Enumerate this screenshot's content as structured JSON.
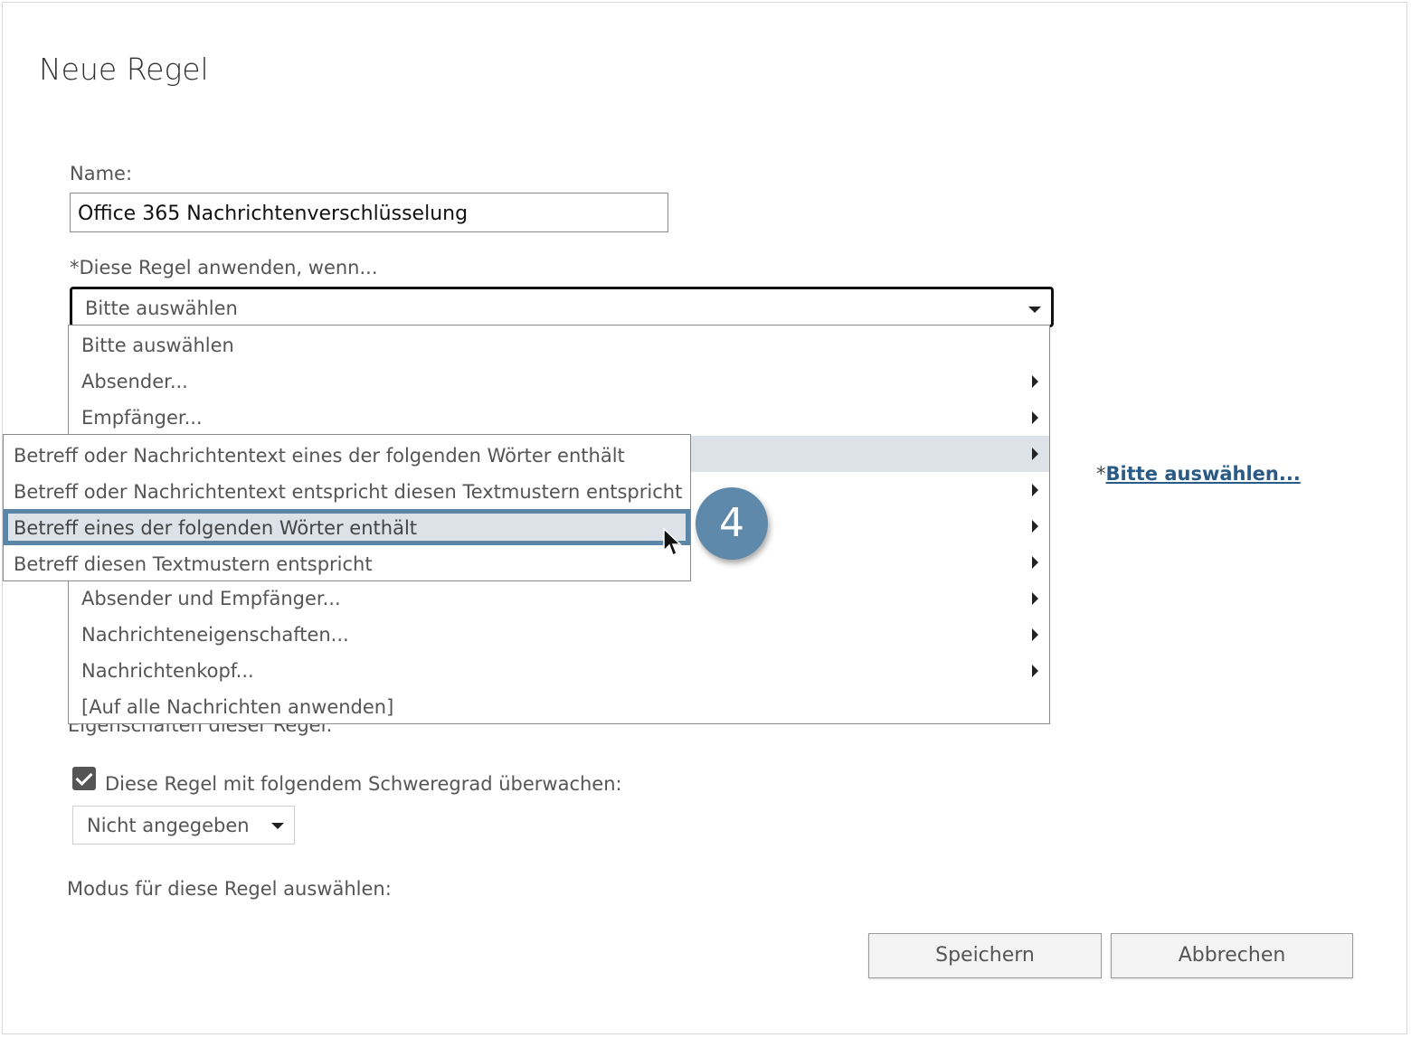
{
  "dialog": {
    "title": "Neue Regel"
  },
  "name_field": {
    "label": "Name:",
    "value": "Office 365 Nachrichtenverschlüsselung"
  },
  "condition": {
    "label": "*Diese Regel anwenden, wenn...",
    "selected": "Bitte auswählen",
    "options": [
      {
        "label": "Bitte auswählen",
        "has_submenu": false
      },
      {
        "label": "Absender...",
        "has_submenu": true
      },
      {
        "label": "Empfänger...",
        "has_submenu": true
      },
      {
        "label": "",
        "has_submenu": true
      },
      {
        "label": "",
        "has_submenu": true
      },
      {
        "label": "",
        "has_submenu": true
      },
      {
        "label": "",
        "has_submenu": true
      },
      {
        "label": "Absender und Empfänger...",
        "has_submenu": true
      },
      {
        "label": "Nachrichteneigenschaften...",
        "has_submenu": true
      },
      {
        "label": "Nachrichtenkopf...",
        "has_submenu": true
      },
      {
        "label": "[Auf alle Nachrichten anwenden]",
        "has_submenu": false
      }
    ],
    "highlighted_index": 3
  },
  "submenu": {
    "items": [
      "Betreff oder Nachrichtentext eines der folgenden Wörter enthält",
      "Betreff oder Nachrichtentext entspricht diesen Textmustern entspricht",
      "Betreff eines der folgenden Wörter enthält",
      "Betreff diesen Textmustern entspricht"
    ],
    "selected_index": 2
  },
  "step_badge": "4",
  "action_link": {
    "prefix": "*",
    "text": "Bitte auswählen..."
  },
  "properties_label": "Eigenschaften dieser Regel:",
  "audit": {
    "checked": true,
    "label": "Diese Regel mit folgendem Schweregrad überwachen:",
    "severity": "Nicht angegeben"
  },
  "mode_label": "Modus für diese Regel auswählen:",
  "buttons": {
    "save": "Speichern",
    "cancel": "Abbrechen"
  },
  "colors": {
    "accent": "#5f89ab",
    "highlight": "#dde2e8",
    "link": "#2a5a86"
  }
}
